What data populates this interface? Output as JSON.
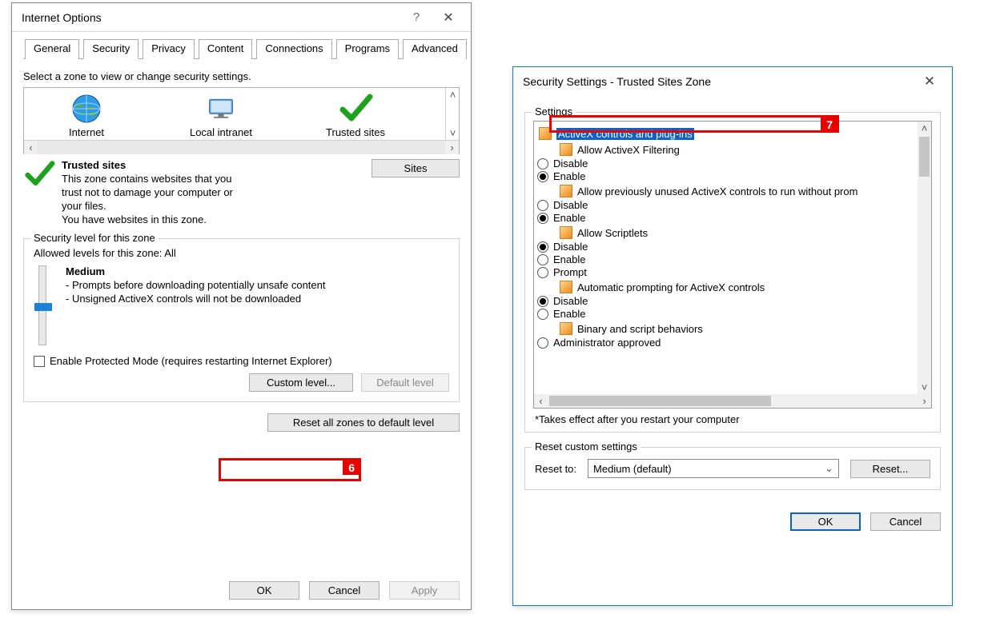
{
  "left": {
    "title": "Internet Options",
    "tabs": [
      "General",
      "Security",
      "Privacy",
      "Content",
      "Connections",
      "Programs",
      "Advanced"
    ],
    "activeTab": 1,
    "prompt": "Select a zone to view or change security settings.",
    "zones": [
      "Internet",
      "Local intranet",
      "Trusted sites"
    ],
    "desc": {
      "title": "Trusted sites",
      "l1": "This zone contains websites that you",
      "l2": "trust not to damage your computer or",
      "l3": "your files.",
      "l4": "You have websites in this zone."
    },
    "sitesBtn": "Sites",
    "secLevelLegend": "Security level for this zone",
    "allowed": "Allowed levels for this zone: All",
    "level": {
      "name": "Medium",
      "b1": "- Prompts before downloading potentially unsafe content",
      "b2": "- Unsigned ActiveX controls will not be downloaded"
    },
    "protected": "Enable Protected Mode (requires restarting Internet Explorer)",
    "customBtn": "Custom level...",
    "defaultBtn": "Default level",
    "resetZones": "Reset all zones to default level",
    "ok": "OK",
    "cancel": "Cancel",
    "apply": "Apply"
  },
  "right": {
    "title": "Security Settings - Trusted Sites Zone",
    "settingsLegend": "Settings",
    "tree": {
      "root": "ActiveX controls and plug-ins",
      "groups": [
        {
          "label": "Allow ActiveX Filtering",
          "opts": [
            "Disable",
            "Enable"
          ],
          "sel": 1
        },
        {
          "label": "Allow previously unused ActiveX controls to run without prom",
          "opts": [
            "Disable",
            "Enable"
          ],
          "sel": 1
        },
        {
          "label": "Allow Scriptlets",
          "opts": [
            "Disable",
            "Enable",
            "Prompt"
          ],
          "sel": 0
        },
        {
          "label": "Automatic prompting for ActiveX controls",
          "opts": [
            "Disable",
            "Enable"
          ],
          "sel": 0
        },
        {
          "label": "Binary and script behaviors",
          "opts": [
            "Administrator approved"
          ],
          "sel": -1
        }
      ]
    },
    "note": "*Takes effect after you restart your computer",
    "resetLegend": "Reset custom settings",
    "resetTo": "Reset to:",
    "resetValue": "Medium (default)",
    "resetBtn": "Reset...",
    "ok": "OK",
    "cancel": "Cancel"
  },
  "annotations": {
    "n6": "6",
    "n7": "7"
  }
}
